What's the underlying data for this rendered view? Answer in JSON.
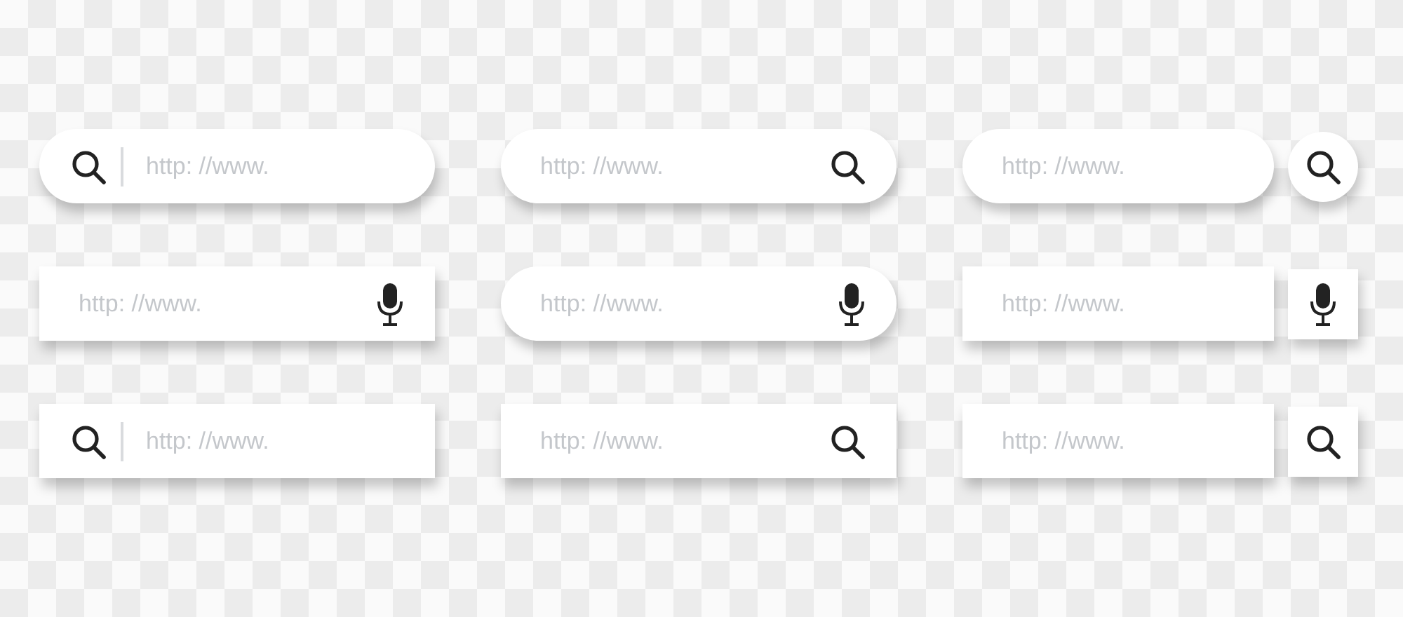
{
  "search_bars": [
    {
      "field": {
        "kind": "pill",
        "placeholder": "http: //www."
      },
      "leading_icon": {
        "kind": "search"
      }
    },
    {
      "field": {
        "kind": "pill",
        "placeholder": "http: //www."
      },
      "trailing_icon": {
        "kind": "search"
      }
    },
    {
      "field": {
        "kind": "pill",
        "placeholder": "http: //www."
      },
      "button": {
        "kind": "search"
      }
    },
    {
      "field": {
        "kind": "square",
        "placeholder": "http: //www."
      },
      "trailing_icon": {
        "kind": "mic"
      }
    },
    {
      "field": {
        "kind": "pill",
        "placeholder": "http: //www."
      },
      "trailing_icon": {
        "kind": "mic"
      }
    },
    {
      "field": {
        "kind": "square",
        "placeholder": "http: //www."
      },
      "button": {
        "kind": "mic"
      }
    },
    {
      "field": {
        "kind": "square",
        "placeholder": "http: //www."
      },
      "leading_icon": {
        "kind": "search"
      }
    },
    {
      "field": {
        "kind": "square",
        "placeholder": "http: //www."
      },
      "trailing_icon": {
        "kind": "search"
      }
    },
    {
      "field": {
        "kind": "square",
        "placeholder": "http: //www."
      },
      "button": {
        "kind": "search"
      }
    }
  ]
}
